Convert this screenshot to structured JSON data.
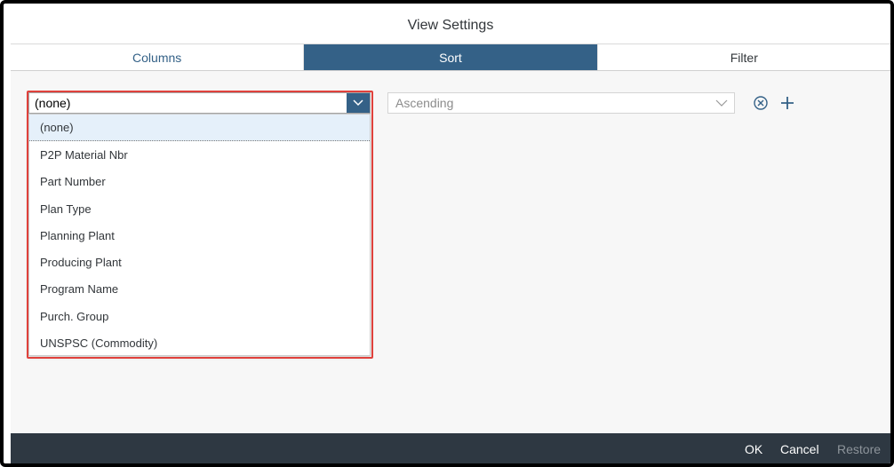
{
  "dialog": {
    "title": "View Settings"
  },
  "tabs": [
    {
      "label": "Columns",
      "active": false
    },
    {
      "label": "Sort",
      "active": true
    },
    {
      "label": "Filter",
      "active": false
    }
  ],
  "sort": {
    "field_value": "(none)",
    "order_placeholder": "Ascending",
    "options": [
      "(none)",
      "P2P Material Nbr",
      "Part Number",
      "Plan Type",
      "Planning Plant",
      "Producing Plant",
      "Program Name",
      "Purch. Group",
      "UNSPSC (Commodity)"
    ],
    "selected_index": 0
  },
  "footer": {
    "ok_label": "OK",
    "cancel_label": "Cancel",
    "restore_label": "Restore"
  },
  "colors": {
    "accent": "#346187",
    "footer_bg": "#2e3842",
    "highlight": "#e0413c"
  },
  "icons": {
    "field_dropdown": "chevron-down-icon",
    "order_dropdown": "chevron-down-icon",
    "remove": "close-circle-icon",
    "add": "plus-icon"
  }
}
